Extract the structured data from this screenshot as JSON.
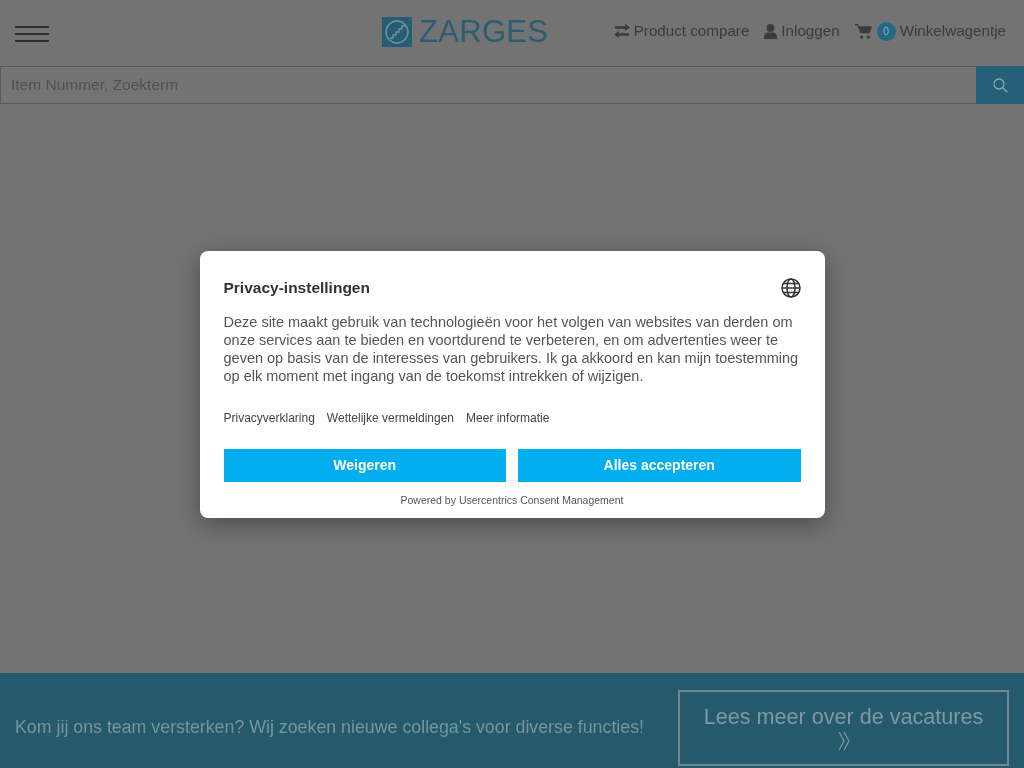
{
  "header": {
    "logo": {
      "text": "ZARGES"
    },
    "nav": [
      {
        "kind": "compare",
        "label": "Product compare"
      },
      {
        "kind": "account",
        "label": "Inloggen"
      },
      {
        "kind": "cart",
        "label": "Winkelwagentje",
        "badge": "0"
      }
    ]
  },
  "search": {
    "placeholder": "Item Nummer, Zoekterm"
  },
  "consent_dialog": {
    "title": "Privacy-instellingen",
    "body": "Deze site maakt gebruik van technologieën voor het volgen van websites van derden om onze services aan te bieden en voortdurend te verbeteren, en om advertenties weer te geven op basis van de interesses van gebruikers. Ik ga akkoord en kan mijn toestemming op elk moment met ingang van de toekomst intrekken of wijzigen.",
    "links": [
      "Privacyverklaring",
      "Wettelijke vermeldingen",
      "Meer informatie"
    ],
    "buttons": [
      "Weigeren",
      "Alles accepteren"
    ],
    "footer": "Powered by Usercentrics Consent Management"
  },
  "banner": {
    "text": "Kom jij ons team versterken? Wij zoeken nieuwe collega's voor diverse functies!",
    "button": "Lees meer over de vacatures"
  }
}
